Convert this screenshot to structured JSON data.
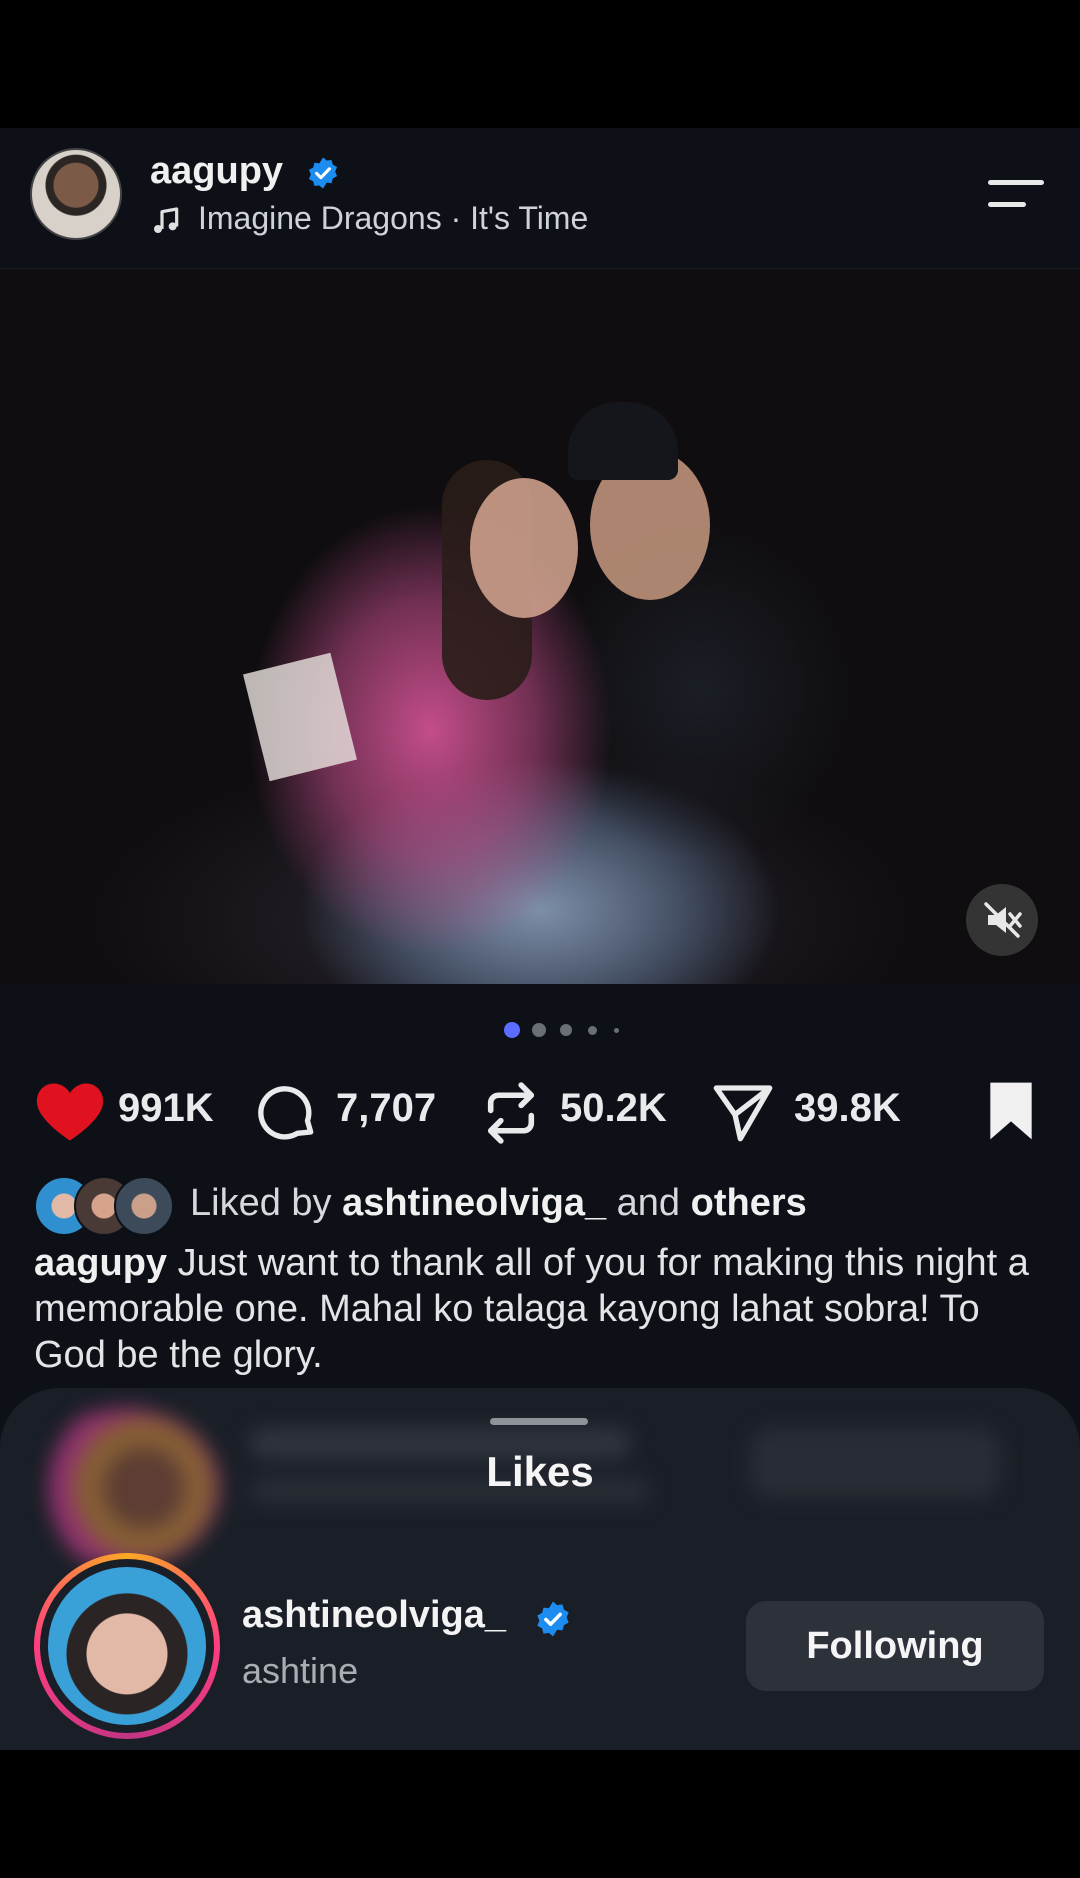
{
  "post": {
    "username": "aagupy",
    "music": "Imagine Dragons · It's Time",
    "carousel": {
      "total": 5,
      "active": 1
    }
  },
  "actions": {
    "likes": "991K",
    "comments": "7,707",
    "reposts": "50.2K",
    "shares": "39.8K"
  },
  "liked_by": {
    "prefix": "Liked by",
    "user": "ashtineolviga_",
    "middle": "and",
    "others": "others"
  },
  "caption": {
    "username": "aagupy",
    "text": "Just want to thank all of you for making this night a memorable one. Mahal ko talaga kayong lahat sobra! To God be the glory."
  },
  "likes_sheet": {
    "title": "Likes",
    "user": {
      "username": "ashtineolviga_",
      "name": "ashtine",
      "button": "Following"
    }
  },
  "colors": {
    "background": "#0d1117",
    "like": "#e1121f",
    "verified": "#1d8cf0",
    "dot_active": "#5b6cff"
  },
  "icons": [
    "verified-badge-icon",
    "music-note-icon",
    "menu-icon",
    "mute-icon",
    "heart-icon",
    "comment-icon",
    "repost-icon",
    "share-icon",
    "bookmark-icon"
  ]
}
